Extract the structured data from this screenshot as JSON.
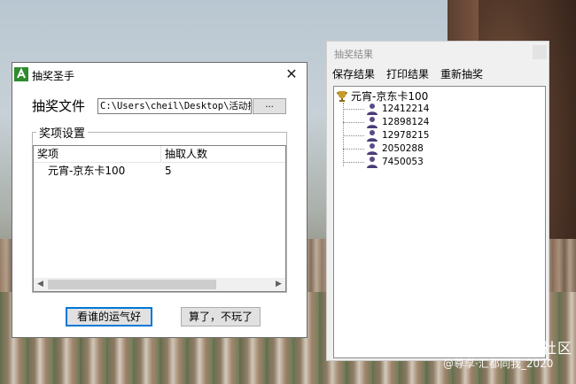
{
  "dialog": {
    "title": "抽奖圣手",
    "file_label": "抽奖文件",
    "file_path": "C:\\Users\\cheil\\Desktop\\活动抽",
    "browse_label": "...",
    "group_title": "奖项设置",
    "columns": [
      "奖项",
      "抽取人数"
    ],
    "rows": [
      {
        "prize": "元宵-京东卡100",
        "count": "5"
      }
    ],
    "lucky_button": "看谁的运气好",
    "quit_button": "算了，不玩了"
  },
  "results": {
    "title": "抽奖结果",
    "menu": [
      "保存结果",
      "打印结果",
      "重新抽奖"
    ],
    "root": "元宵-京东卡100",
    "winners": [
      "12412214",
      "12898124",
      "12978215",
      "2050288",
      "7450053"
    ]
  },
  "watermark": {
    "line1": "盖乐世社区",
    "line2": "@尊享·汇都同我_2020"
  }
}
